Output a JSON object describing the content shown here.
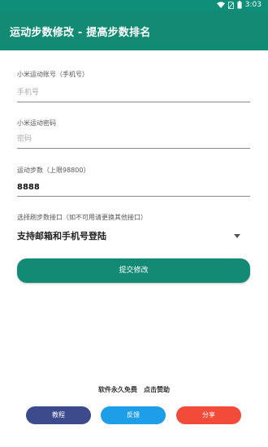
{
  "status_bar": {
    "time": "3:03"
  },
  "header": {
    "title": "运动步数修改 - 提高步数排名"
  },
  "form": {
    "account": {
      "label": "小米运动账号（手机号）",
      "placeholder": "手机号"
    },
    "password": {
      "label": "小米运动密码",
      "placeholder": "密码"
    },
    "steps": {
      "label": "运动步数（上限98800）",
      "value": "8888"
    },
    "interface": {
      "label": "选择刷步数接口（如不可用请更换其他接口）",
      "selected": "支持邮箱和手机号登陆"
    },
    "submit_label": "提交修改"
  },
  "footer": {
    "free_text": "软件永久免费",
    "sponsor_text": "点击赞助",
    "buttons": {
      "tutorial": "教程",
      "feedback": "反馈",
      "share": "分享"
    }
  },
  "colors": {
    "primary": "#138a74",
    "tutorial": "#3d4a8b",
    "feedback": "#1e9ee8",
    "share": "#f24b3a"
  }
}
